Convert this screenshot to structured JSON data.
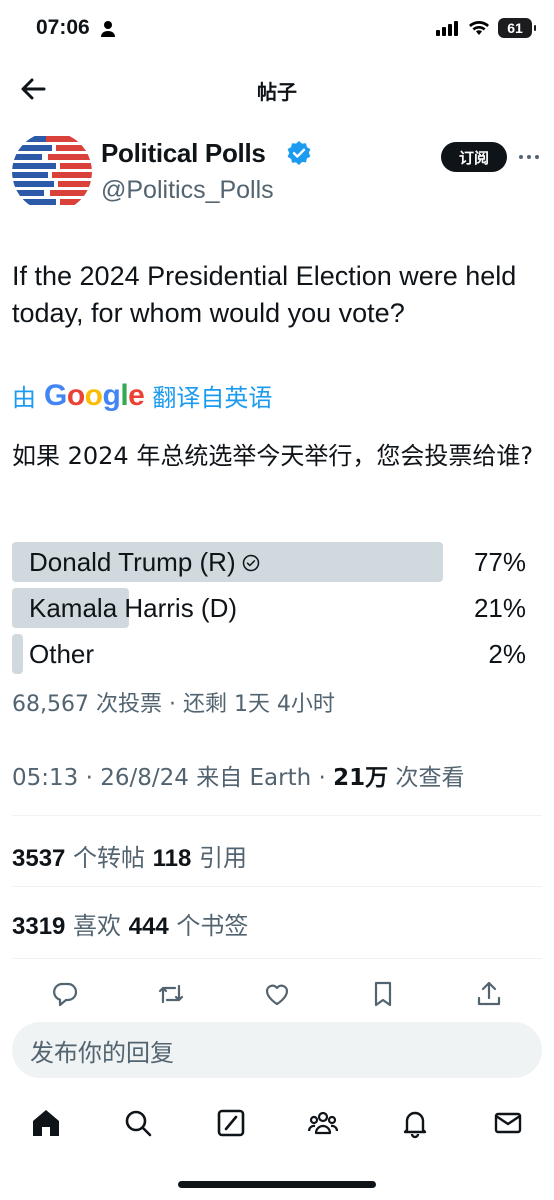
{
  "status_bar": {
    "time": "07:06",
    "battery": "61"
  },
  "header": {
    "title": "帖子"
  },
  "author": {
    "name": "Political Polls",
    "handle": "@Politics_Polls",
    "subscribe_label": "订阅"
  },
  "tweet": {
    "text": "If the 2024 Presidential Election were held today, for whom would you vote?",
    "translate_prefix": "由",
    "translate_brand": "Google",
    "translate_suffix": "翻译自英语",
    "translated_text": "如果 2024 年总统选举今天举行，您会投票给谁?"
  },
  "poll": {
    "options": [
      {
        "label": "Donald Trump (R)",
        "percent_text": "77%",
        "percent": 77,
        "selected": true
      },
      {
        "label": "Kamala Harris (D)",
        "percent_text": "21%",
        "percent": 21,
        "selected": false
      },
      {
        "label": "Other",
        "percent_text": "2%",
        "percent": 2,
        "selected": false
      }
    ],
    "meta": "68,567 次投票 · 还剩 1天 4小时"
  },
  "meta": {
    "time_source": "05:13 · 26/8/24 来自 Earth · ",
    "views_count": "21万",
    "views_label": " 次查看"
  },
  "stats": {
    "reposts_count": "3537",
    "reposts_label": " 个转帖 ",
    "quotes_count": "118",
    "quotes_label": " 引用",
    "likes_count": "3319",
    "likes_label": " 喜欢 ",
    "bookmarks_count": "444",
    "bookmarks_label": " 个书签"
  },
  "actions": [
    "reply-icon",
    "repost-icon",
    "like-icon",
    "bookmark-icon",
    "share-icon"
  ],
  "reply_box": {
    "placeholder": "发布你的回复"
  },
  "nav": [
    "home-icon",
    "search-icon",
    "grok-icon",
    "communities-icon",
    "notifications-icon",
    "messages-icon"
  ],
  "colors": {
    "accent": "#1d9bf0",
    "text": "#0f1419",
    "muted": "#536471",
    "poll_bar": "#cfd9de",
    "avatar_red": "#d9413a",
    "avatar_blue": "#2c5aa8"
  }
}
